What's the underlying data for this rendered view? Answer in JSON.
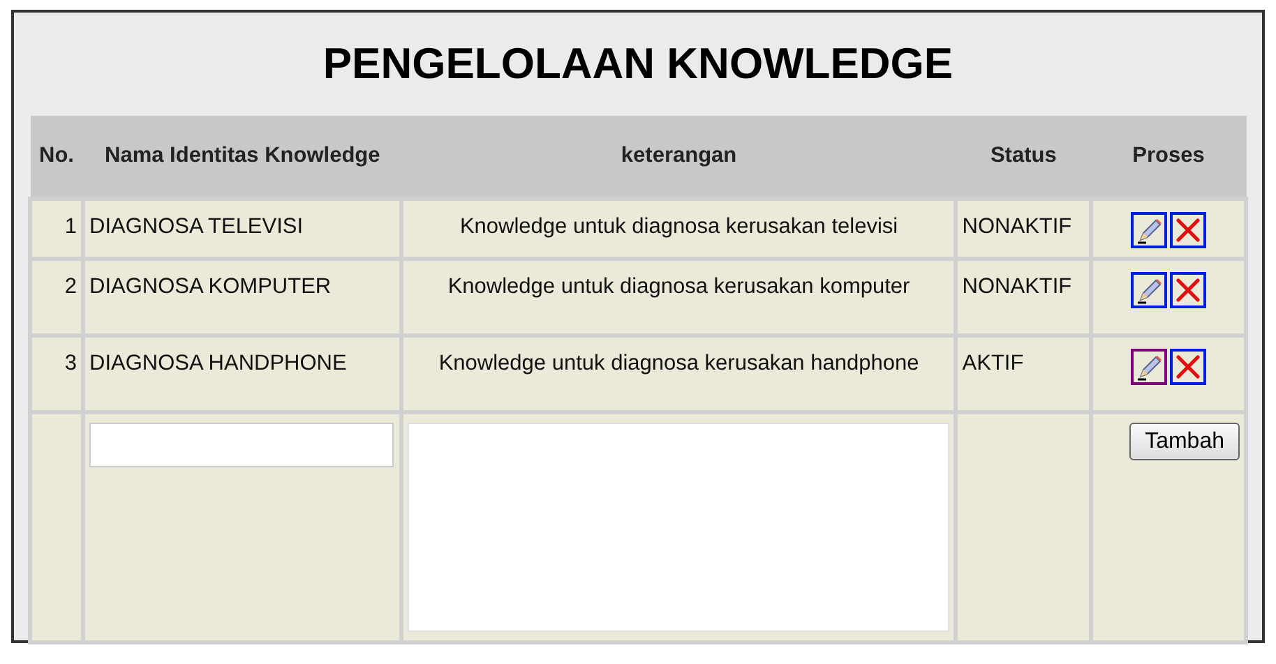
{
  "title": "PENGELOLAAN KNOWLEDGE",
  "table": {
    "columns": [
      "No.",
      "Nama Identitas Knowledge",
      "keterangan",
      "Status",
      "Proses"
    ],
    "rows": [
      {
        "no": "1",
        "name": "DIAGNOSA TELEVISI",
        "description": "Knowledge untuk diagnosa kerusakan televisi",
        "status": "NONAKTIF",
        "edit_visited": false
      },
      {
        "no": "2",
        "name": "DIAGNOSA KOMPUTER",
        "description": "Knowledge untuk diagnosa kerusakan komputer",
        "status": "NONAKTIF",
        "edit_visited": false
      },
      {
        "no": "3",
        "name": "DIAGNOSA HANDPHONE",
        "description": "Knowledge untuk diagnosa kerusakan handphone",
        "status": "AKTIF",
        "edit_visited": true
      }
    ]
  },
  "form": {
    "button": "Tambah"
  }
}
